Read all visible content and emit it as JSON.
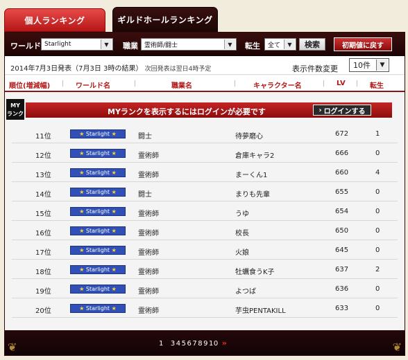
{
  "tabs": [
    {
      "label": "個人ランキング"
    },
    {
      "label": "ギルドホールランキング"
    }
  ],
  "filters": {
    "world_label": "ワールド",
    "world_value": "Starlight",
    "job_label": "職業",
    "job_value": "霊術師/闘士",
    "rebirth_label": "転生",
    "rebirth_value": "全て",
    "search_label": "検索",
    "reset_label": "初期値に戻す"
  },
  "info": {
    "date_main": "2014年7月3日発表（7月3日 3時の結果）",
    "date_next": "次回発表は翌日4時予定",
    "count_label": "表示件数変更",
    "count_value": "10件"
  },
  "columns": [
    "順位(増減幅)",
    "ワールド名",
    "職業名",
    "キャラクター名",
    "LV",
    "転生"
  ],
  "myrank": {
    "badge_line1": "MY",
    "badge_line2": "ランク",
    "message": "MYランクを表示するにはログインが必要です",
    "login_label": "ログインする"
  },
  "rows": [
    {
      "rank": "11位",
      "world": "Starlight",
      "job": "闘士",
      "name": "待夢磨心",
      "lv": "672",
      "rebirth": "1"
    },
    {
      "rank": "12位",
      "world": "Starlight",
      "job": "霊術師",
      "name": "倉庫キャラ2",
      "lv": "666",
      "rebirth": "0"
    },
    {
      "rank": "13位",
      "world": "Starlight",
      "job": "霊術師",
      "name": "まーくん1",
      "lv": "660",
      "rebirth": "4"
    },
    {
      "rank": "14位",
      "world": "Starlight",
      "job": "闘士",
      "name": "まりも先輩",
      "lv": "655",
      "rebirth": "0"
    },
    {
      "rank": "15位",
      "world": "Starlight",
      "job": "霊術師",
      "name": "うゆ",
      "lv": "654",
      "rebirth": "0"
    },
    {
      "rank": "16位",
      "world": "Starlight",
      "job": "霊術師",
      "name": "校長",
      "lv": "650",
      "rebirth": "0"
    },
    {
      "rank": "17位",
      "world": "Starlight",
      "job": "霊術師",
      "name": "火娘",
      "lv": "645",
      "rebirth": "0"
    },
    {
      "rank": "18位",
      "world": "Starlight",
      "job": "霊術師",
      "name": "牡蠣食うK子",
      "lv": "637",
      "rebirth": "2"
    },
    {
      "rank": "19位",
      "world": "Starlight",
      "job": "霊術師",
      "name": "よつば",
      "lv": "636",
      "rebirth": "0"
    },
    {
      "rank": "20位",
      "world": "Starlight",
      "job": "霊術師",
      "name": "芋虫PENTAKILL",
      "lv": "633",
      "rebirth": "0"
    }
  ],
  "pager": {
    "pages": [
      "1",
      "3",
      "4",
      "5",
      "6",
      "7",
      "8",
      "9",
      "10"
    ],
    "next": "»"
  },
  "colors": {
    "accent_red": "#b01818",
    "world_badge": "#3050b8",
    "frame_dark": "#1e0404"
  }
}
